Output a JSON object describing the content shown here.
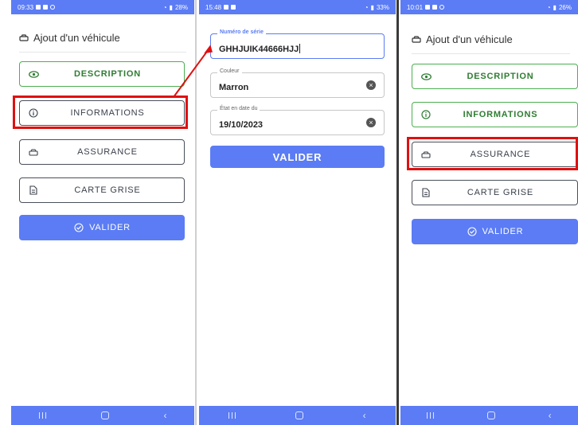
{
  "screens": [
    {
      "status": {
        "time": "09:33",
        "battery": "28%"
      },
      "header": {
        "title": "Ajout d'un véhicule"
      },
      "buttons": {
        "description": "DESCRIPTION",
        "informations": "INFORMATIONS",
        "assurance": "ASSURANCE",
        "carte_grise": "CARTE GRISE",
        "valider": "VALIDER"
      }
    },
    {
      "status": {
        "time": "15:48",
        "battery": "33%"
      },
      "fields": {
        "serial": {
          "label": "Numéro de série",
          "value": "GHHJUIK44666HJJ"
        },
        "color": {
          "label": "Couleur",
          "value": "Marron"
        },
        "date": {
          "label": "État en date du",
          "value": "19/10/2023"
        }
      },
      "buttons": {
        "valider": "VALIDER"
      }
    },
    {
      "status": {
        "time": "10:01",
        "battery": "26%"
      },
      "header": {
        "title": "Ajout d'un véhicule"
      },
      "buttons": {
        "description": "DESCRIPTION",
        "informations": "INFORMATIONS",
        "assurance": "ASSURANCE",
        "carte_grise": "CARTE GRISE",
        "valider": "VALIDER"
      }
    }
  ],
  "colors": {
    "primary": "#5b7cf4",
    "success": "#4caf50",
    "highlight": "#e01010"
  },
  "icons": {
    "description": "eye-icon",
    "informations": "info-icon",
    "assurance": "car-icon",
    "carte_grise": "document-icon",
    "valider": "check-circle-icon",
    "clear": "clear-icon"
  }
}
